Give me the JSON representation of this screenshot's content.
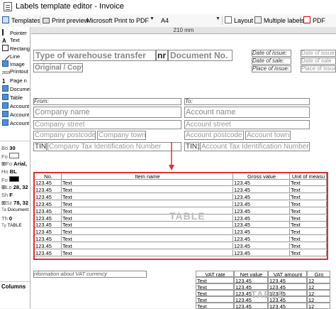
{
  "window": {
    "title": "Labels template editor - Invoice"
  },
  "toolbar": {
    "templates": "Templates",
    "print_preview": "Print preview",
    "printer": "Microsoft Print to PDF",
    "paper": "A4",
    "layout": "Layout",
    "multiple_labels": "Multiple labels",
    "pdf": "PDF"
  },
  "tools": [
    "Pointer",
    "Text",
    "Rectangle",
    "Line",
    "Image",
    "Printout",
    "Page n",
    "Document",
    "Table",
    "Account",
    "Account",
    "Account"
  ],
  "props": [
    {
      "label": "Bo",
      "value": "30"
    },
    {
      "label": "Fo",
      "value": ""
    },
    {
      "label": "Fo",
      "value": "Arial,"
    },
    {
      "label": "Ho",
      "value": "BL"
    },
    {
      "label": "Fo",
      "value": ""
    },
    {
      "label": "Lo",
      "value": "28, 32"
    },
    {
      "label": "Sh",
      "value": "F"
    },
    {
      "label": "Sz",
      "value": "78, 32"
    },
    {
      "label": "Ta",
      "value": "Document"
    },
    {
      "label": "Th",
      "value": "0"
    },
    {
      "label": "Ty",
      "value": "TABLE"
    }
  ],
  "columns_tab": "Columns",
  "ruler": "210 mm",
  "doc": {
    "title_a": "Type of warehouse transfer",
    "title_nr": "nr",
    "title_b": "Document No.",
    "original": "Original / Copy",
    "date_issue": "Date of issue:",
    "date_sale": "Date of sale:",
    "place_issue": "Place of issue:",
    "date_issue_v": "Date of issue",
    "date_sale_v": "Date of sale",
    "place_issue_v": "Place of issue",
    "from": "From:",
    "to": "To:",
    "company_name": "Company name",
    "company_street": "Company street",
    "company_postcode": "Company postcode",
    "company_town": "Company town",
    "company_tin_label": "TIN:",
    "company_tin": "Company Tax Identification Number",
    "account_name": "Account name",
    "account_street": "Account street",
    "account_postcode": "Account postcode",
    "account_town": "Account town",
    "account_tin_label": "TIN:",
    "account_tin": "Account Tax Identification Number",
    "vat_info": "nformation about VAT currency"
  },
  "table": {
    "headers": [
      "No.",
      "Item name",
      "Gross value",
      "Unit of measu"
    ],
    "rows": [
      [
        "123.45",
        "Text",
        "123.45",
        "Text"
      ],
      [
        "123.45",
        "Text",
        "123.45",
        "Text"
      ],
      [
        "123.45",
        "Text",
        "123.45",
        "Text"
      ],
      [
        "123.45",
        "Text",
        "123.45",
        "Text"
      ],
      [
        "123.45",
        "Text",
        "123.45",
        "Text"
      ],
      [
        "123.45",
        "Text",
        "123.45",
        "Text"
      ],
      [
        "123.45",
        "Text",
        "123.45",
        "Text"
      ],
      [
        "123.45",
        "Text",
        "123.45",
        "Text"
      ],
      [
        "123.45",
        "Text",
        "123.45",
        "Text"
      ],
      [
        "123.45",
        "Text",
        "123.45",
        "Text"
      ],
      [
        "123.45",
        "Text",
        "123.45",
        "Text"
      ]
    ],
    "watermark": "TABLE"
  },
  "vat_table": {
    "headers": [
      "VAT rate",
      "Net value",
      "VAT amount",
      "Gro"
    ],
    "rows": [
      [
        "Text",
        "123.45",
        "123.45",
        "12"
      ],
      [
        "Text",
        "123.45",
        "123.45",
        "12"
      ],
      [
        "Text",
        "123.45",
        "123.45",
        "12"
      ],
      [
        "Text",
        "123.45",
        "123.45",
        "12"
      ],
      [
        "Text",
        "123.45",
        "123.45",
        "12"
      ]
    ],
    "watermark": "TABLE"
  },
  "colors": {
    "selection": "#e03030",
    "arrow": "#e03030"
  }
}
